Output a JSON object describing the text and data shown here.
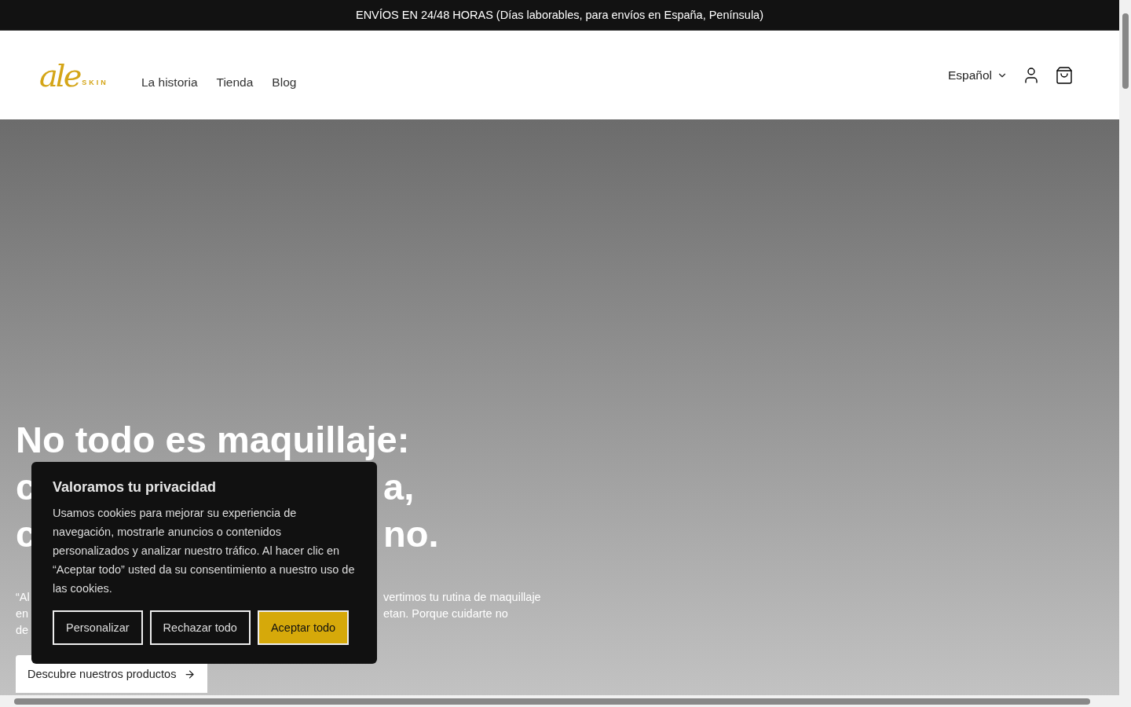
{
  "announcement": "ENVÍOS EN 24/48 HORAS (Días laborables, para envíos en España, Península)",
  "header": {
    "logo": {
      "script": "ale",
      "word": "SKIN"
    },
    "nav": [
      {
        "label": "La historia"
      },
      {
        "label": "Tienda"
      },
      {
        "label": "Blog"
      }
    ],
    "language": "Español"
  },
  "hero": {
    "heading_lines": [
      {
        "left": "No todo es maquillaje:"
      },
      {
        "left": "c",
        "right": "a,"
      },
      {
        "left": "c",
        "right": "no."
      }
    ],
    "text_lines": [
      {
        "left": "“Al",
        "right": "vertimos tu rutina de maquillaje"
      },
      {
        "left": "en",
        "right": "etan. Porque cuidarte no"
      },
      {
        "left": "de"
      }
    ],
    "button": "Descubre nuestros productos"
  },
  "cookie_banner": {
    "title": "Valoramos tu privacidad",
    "body": "Usamos cookies para mejorar su experiencia de navegación, mostrarle anuncios o contenidos personalizados y analizar nuestro tráfico. Al hacer clic en “Aceptar todo” usted da su consentimiento a nuestro uso de las cookies.",
    "buttons": [
      {
        "label": "Personalizar",
        "kind": "outline"
      },
      {
        "label": "Rechazar todo",
        "kind": "outline"
      },
      {
        "label": "Aceptar todo",
        "kind": "primary"
      }
    ]
  }
}
